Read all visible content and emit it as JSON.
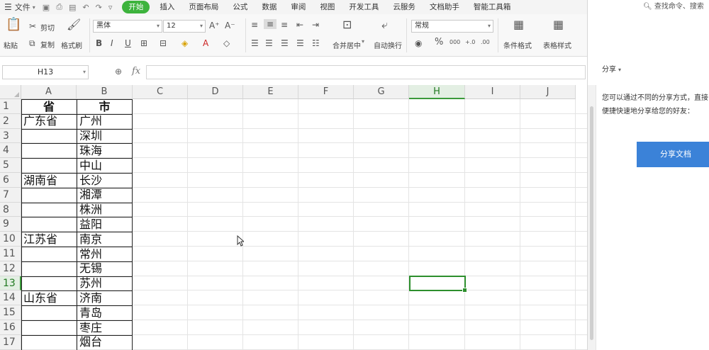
{
  "menubar": {
    "file_label": "文件",
    "tabs": [
      {
        "label": "开始",
        "active": true
      },
      {
        "label": "插入"
      },
      {
        "label": "页面布局"
      },
      {
        "label": "公式"
      },
      {
        "label": "数据"
      },
      {
        "label": "审阅"
      },
      {
        "label": "视图"
      },
      {
        "label": "开发工具"
      },
      {
        "label": "云服务"
      },
      {
        "label": "文档助手"
      },
      {
        "label": "智能工具箱"
      }
    ],
    "search_placeholder": "查找命令、搜索"
  },
  "ribbon": {
    "paste_label": "粘贴",
    "cut_label": "剪切",
    "copy_label": "复制",
    "format_painter_label": "格式刷",
    "font_name": "黑体",
    "font_size": "12",
    "bold": "B",
    "italic": "I",
    "underline": "U",
    "merge_label": "合并居中",
    "wrap_label": "自动换行",
    "number_format": "常规",
    "percent": "%",
    "thousands": "000",
    "conditional_format_label": "条件格式",
    "table_style_label": "表格样式"
  },
  "formula_bar": {
    "name_box": "H13",
    "fx_label": "fx",
    "formula": ""
  },
  "sheet": {
    "columns": [
      "A",
      "B",
      "C",
      "D",
      "E",
      "F",
      "G",
      "H",
      "I",
      "J"
    ],
    "selected_column": "H",
    "selected_row": "13",
    "selected_cell": "H13",
    "rows": [
      {
        "num": "1",
        "a": "省",
        "b": "市"
      },
      {
        "num": "2",
        "a": "广东省",
        "b": "广州"
      },
      {
        "num": "3",
        "a": "",
        "b": "深圳"
      },
      {
        "num": "4",
        "a": "",
        "b": "珠海"
      },
      {
        "num": "5",
        "a": "",
        "b": "中山"
      },
      {
        "num": "6",
        "a": "湖南省",
        "b": "长沙"
      },
      {
        "num": "7",
        "a": "",
        "b": "湘潭"
      },
      {
        "num": "8",
        "a": "",
        "b": "株洲"
      },
      {
        "num": "9",
        "a": "",
        "b": "益阳"
      },
      {
        "num": "10",
        "a": "江苏省",
        "b": "南京"
      },
      {
        "num": "11",
        "a": "",
        "b": "常州"
      },
      {
        "num": "12",
        "a": "",
        "b": "无锡"
      },
      {
        "num": "13",
        "a": "",
        "b": "苏州"
      },
      {
        "num": "14",
        "a": "山东省",
        "b": "济南"
      },
      {
        "num": "15",
        "a": "",
        "b": "青岛"
      },
      {
        "num": "16",
        "a": "",
        "b": "枣庄"
      },
      {
        "num": "17",
        "a": "",
        "b": "烟台"
      }
    ]
  },
  "share_panel": {
    "title": "分享",
    "description_line1": "您可以通过不同的分享方式，直接",
    "description_line2": "便捷快速地分享给您的好友：",
    "button_label": "分享文档"
  },
  "colors": {
    "accent_green": "#3db33d",
    "selection_green": "#2d8f2d",
    "share_blue": "#3b82d8"
  }
}
